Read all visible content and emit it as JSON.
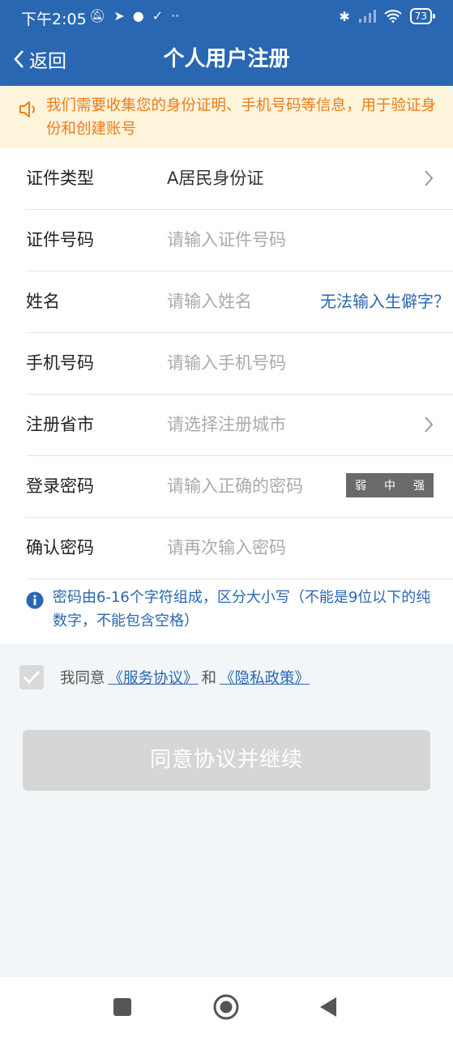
{
  "status": {
    "time": "下午2:05",
    "battery": "73"
  },
  "nav": {
    "back_label": "返回",
    "title": "个人用户注册"
  },
  "notice": {
    "text": "我们需要收集您的身份证明、手机号码等信息，用于验证身份和创建账号"
  },
  "form": {
    "id_type": {
      "label": "证件类型",
      "value": "A居民身份证"
    },
    "id_number": {
      "label": "证件号码",
      "placeholder": "请输入证件号码"
    },
    "name": {
      "label": "姓名",
      "placeholder": "请输入姓名",
      "help_link": "无法输入生僻字？"
    },
    "phone": {
      "label": "手机号码",
      "placeholder": "请输入手机号码"
    },
    "city": {
      "label": "注册省市",
      "placeholder": "请选择注册城市"
    },
    "password": {
      "label": "登录密码",
      "placeholder": "请输入正确的密码",
      "strength": [
        "弱",
        "中",
        "强"
      ]
    },
    "confirm_password": {
      "label": "确认密码",
      "placeholder": "请再次输入密码"
    }
  },
  "hint": {
    "text": "密码由6-16个字符组成，区分大小写（不能是9位以下的纯数字，不能包含空格）"
  },
  "agreement": {
    "prefix": "我同意",
    "service": "《服务协议》",
    "and": "和",
    "privacy": "《隐私政策》"
  },
  "submit_label": "同意协议并继续",
  "colors": {
    "primary": "#2a67b3",
    "notice_bg": "#fdf4dc",
    "notice_text": "#f07b18",
    "disabled": "#d6d6d6"
  }
}
